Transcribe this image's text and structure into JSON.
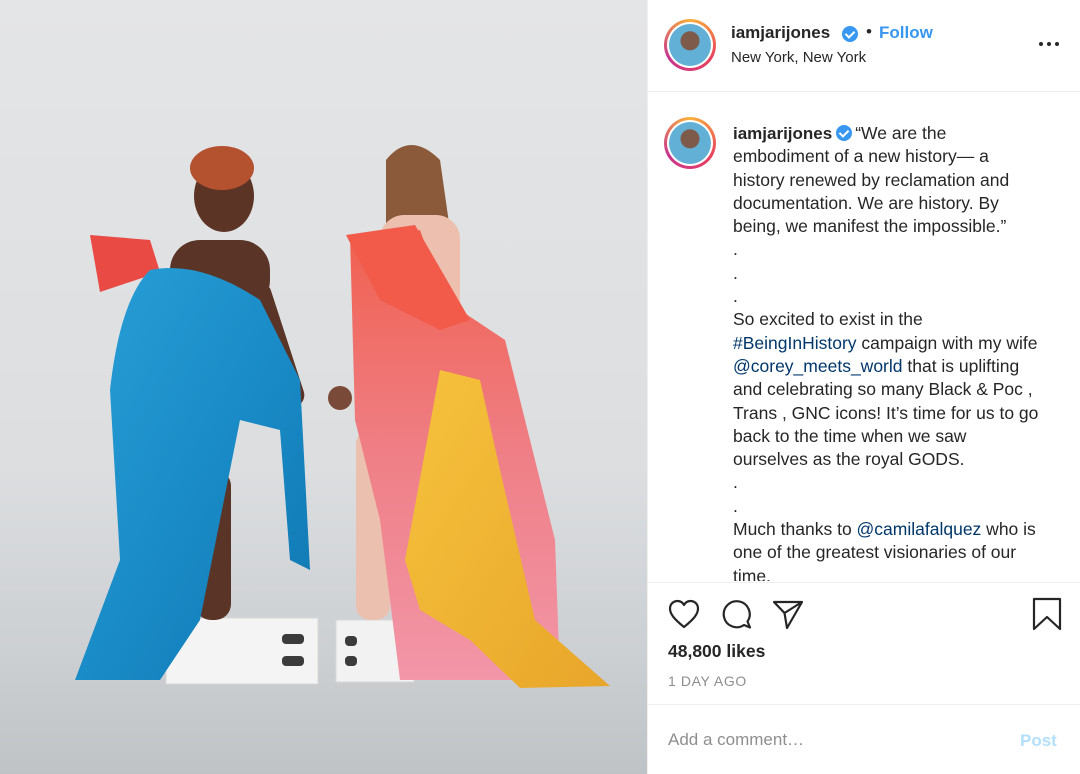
{
  "post": {
    "image_alt": "Two women draped in blue, pink and yellow fabric standing on white boxes holding hands",
    "header": {
      "username": "iamjarijones",
      "verified": true,
      "separator": "•",
      "follow_label": "Follow",
      "location": "New York, New York"
    },
    "caption": {
      "username": "iamjarijones",
      "lines": [
        "“We are the",
        "embodiment of a new history— a",
        "history renewed by reclamation and",
        "documentation. We are history. By",
        "being, we manifest the impossible.”",
        ".",
        ".",
        ".",
        "So excited to exist in the",
        "#BeingInHistory",
        " campaign with my wife",
        "@corey_meets_world",
        " that is uplifting",
        "and celebrating so many Black & Poc ,",
        "Trans , GNC icons! It’s time for us to go",
        "back to the time when we saw",
        "ourselves as the royal GODS.",
        ".",
        ".",
        "Much thanks to ",
        "@camilafalquez",
        " who is",
        "one of the greatest visionaries of our",
        "time."
      ]
    },
    "actions": {
      "like_icon": "heart-icon",
      "comment_icon": "comment-icon",
      "share_icon": "paper-plane-icon",
      "save_icon": "bookmark-icon"
    },
    "likes": "48,800 likes",
    "time_ago": "1 DAY AGO",
    "comment": {
      "placeholder": "Add a comment…",
      "post_label": "Post"
    },
    "colors": {
      "accent": "#3897f0",
      "link": "#00376b",
      "post_disabled": "#b2dffc",
      "muted": "#8e8e8e"
    }
  }
}
